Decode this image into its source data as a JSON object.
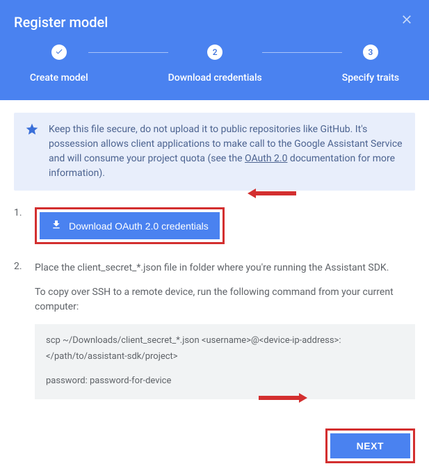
{
  "header": {
    "title": "Register model"
  },
  "stepper": {
    "steps": [
      {
        "label": "Create model"
      },
      {
        "num": "2",
        "label": "Download credentials"
      },
      {
        "num": "3",
        "label": "Specify traits"
      }
    ]
  },
  "info": {
    "text_before_link": "Keep this file secure, do not upload it to public repositories like GitHub. It's possession allows client applications to make call to the Google Assistant Service and will consume your project quota (see the ",
    "link_text": "OAuth 2.0",
    "text_after_link": " documentation for more information)."
  },
  "list": {
    "item1": {
      "num": "1.",
      "button": "Download OAuth 2.0 credentials"
    },
    "item2": {
      "num": "2.",
      "text1": "Place the client_secret_*.json file in folder where you're running the Assistant SDK.",
      "text2": "To copy over SSH to a remote device, run the following command from your current computer:",
      "code": {
        "line1": "scp ~/Downloads/client_secret_*.json <username>@<device-ip-address>:",
        "line2": "</path/to/assistant-sdk/project>",
        "line3": "password: password-for-device"
      }
    }
  },
  "footer": {
    "next": "NEXT"
  }
}
